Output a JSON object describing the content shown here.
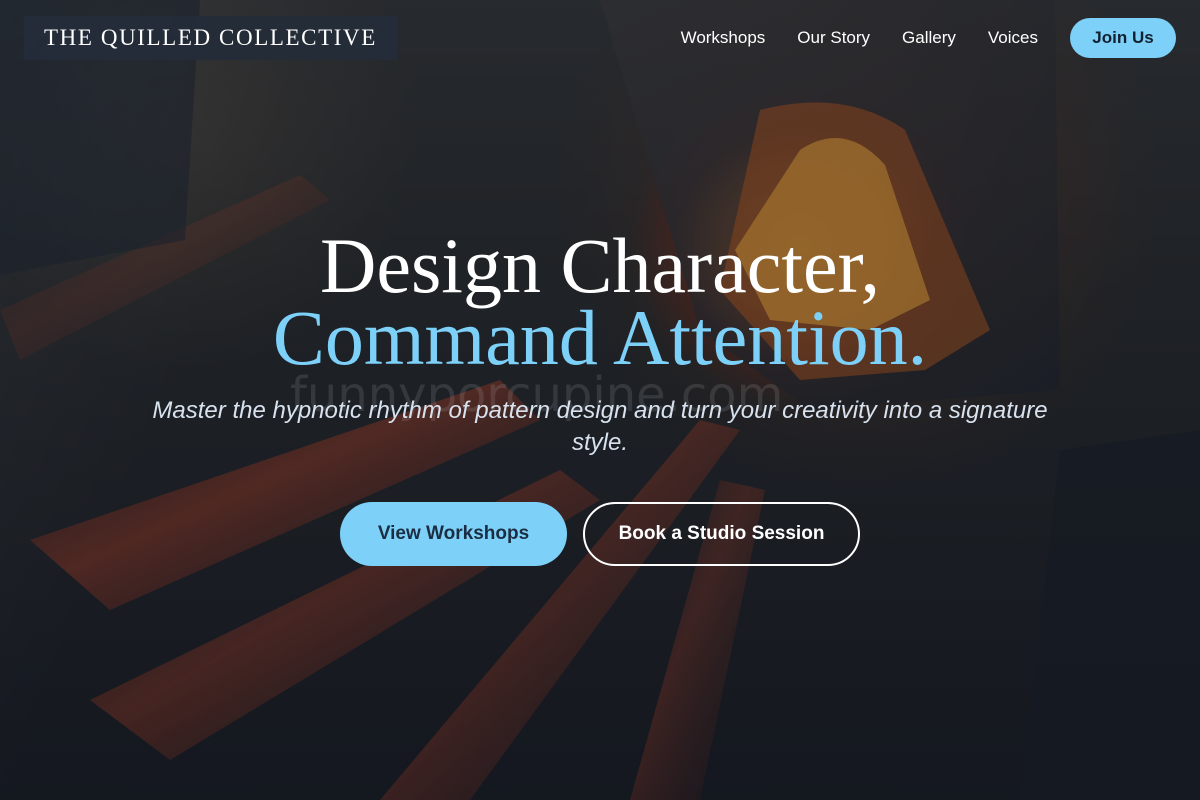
{
  "header": {
    "brand": "THE QUILLED COLLECTIVE",
    "nav": [
      {
        "label": "Workshops"
      },
      {
        "label": "Our Story"
      },
      {
        "label": "Gallery"
      },
      {
        "label": "Voices"
      }
    ],
    "join_label": "Join Us"
  },
  "hero": {
    "title_line_1": "Design Character,",
    "title_line_2": "Command Attention.",
    "subtitle": "Master the hypnotic rhythm of pattern design and turn your creativity into a signature style.",
    "buttons": {
      "primary": "View Workshops",
      "secondary": "Book a Studio Session"
    }
  },
  "watermark": {
    "text": "funnyporcupine.com"
  },
  "colors": {
    "accent": "#7dd0f8",
    "text": "#ffffff",
    "background": "#151a21"
  }
}
